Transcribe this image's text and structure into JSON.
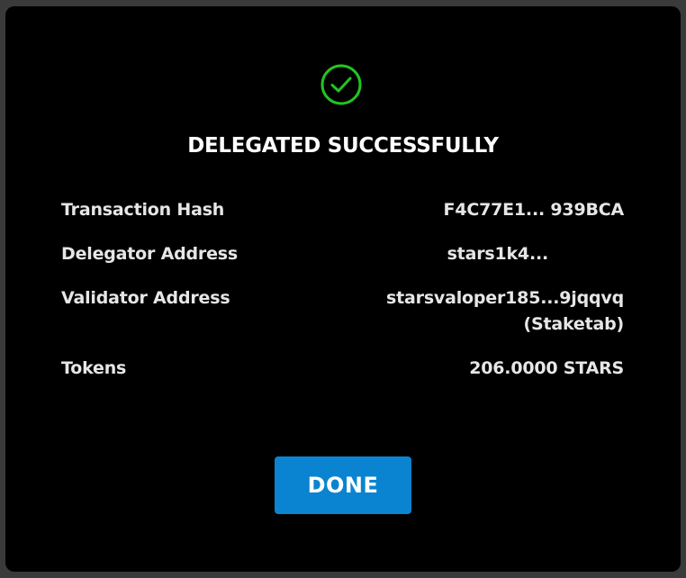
{
  "dialog": {
    "title": "DELEGATED SUCCESSFULLY",
    "status_icon": "check-circle-icon",
    "accent_color": "#21c521",
    "rows": [
      {
        "label": "Transaction Hash",
        "value": "F4C77E1...  939BCA"
      },
      {
        "label": "Delegator Address",
        "value": "stars1k4..."
      },
      {
        "label": "Validator Address",
        "value": "starsvaloper185...9jqqvq",
        "subvalue": "(Staketab)"
      },
      {
        "label": "Tokens",
        "value": "206.0000 STARS"
      }
    ],
    "done_label": "DONE",
    "button_color": "#0a84d0"
  }
}
